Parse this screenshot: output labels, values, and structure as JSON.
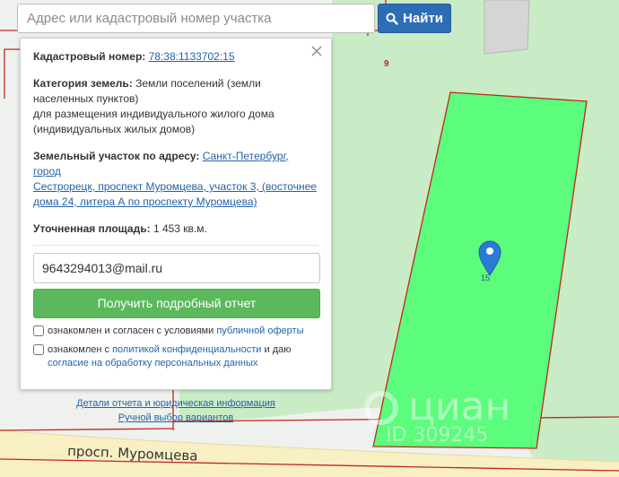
{
  "search": {
    "placeholder": "Адрес или кадастровый номер участка",
    "button_label": "Найти"
  },
  "popup": {
    "cadastral_label": "Кадастровый номер:",
    "cadastral_number": "78:38:1133702:15",
    "category_label": "Категория земель:",
    "category_line1": "Земли поселений (земли",
    "category_line2": "населенных пунктов)",
    "category_line3": "для размещения индивидуального жилого дома",
    "category_line4": "(индивидуальных жилых домов)",
    "address_label": "Земельный участок по адресу:",
    "address_line1": "Санкт-Петербург, город",
    "address_line2": "Сестрорецк, проспект Муромцева, участок 3, (восточнее",
    "address_line3": "дома 24, литера А по проспекту Муромцева)",
    "area_label": "Уточненная площадь:",
    "area_value": "1 453 кв.м.",
    "email_value": "9643294013@mail.ru",
    "report_button": "Получить подробный отчет",
    "consent1_text": "ознакомлен и согласен с условиями ",
    "consent1_link": "публичной оферты",
    "consent2_text": "ознакомлен с ",
    "consent2_link": "политикой конфиденциальности",
    "consent2_mid": " и даю",
    "consent2_link2": "согласие на обработку персональных данных",
    "link_details": "Детали отчета и юридическая информация",
    "link_manual": "Ручной выбор вариантов"
  },
  "map": {
    "street_name": "просп. Муромцева",
    "parcel_number_9": "9",
    "parcel_number_15": "15",
    "watermark_logo": "циан",
    "watermark_id": "ID 309245",
    "parcel_fill": "#5cfc7c",
    "pin_color": "#2b7bd6",
    "boundary_color": "#c0281f"
  }
}
